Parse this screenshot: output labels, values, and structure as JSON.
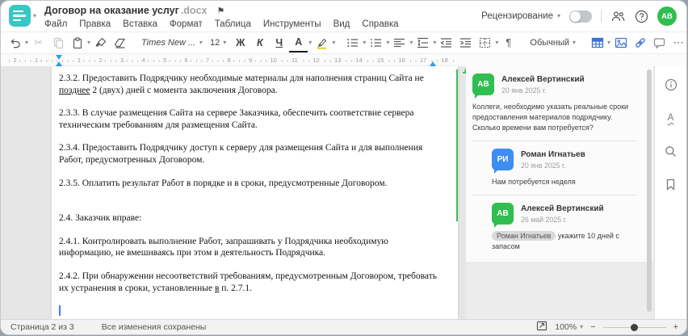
{
  "colors": {
    "teal": "#3ac7c3",
    "accent_blue": "#3d72d9",
    "green": "#2fbe4f",
    "blue_avatar": "#3d8df2",
    "marker_blue": "#2b9ff2",
    "cgreen": "#3fbe5c"
  },
  "icons": {
    "caret": "▾",
    "flag": "⚑",
    "cut": "✂",
    "more": "⋯",
    "minus": "−",
    "plus": "+",
    "pilcrow": "¶",
    "spell_letter": "А"
  },
  "app": {
    "title": "Договор на оказание услуг",
    "ext": ".docx"
  },
  "header": {
    "menu": [
      "Файл",
      "Правка",
      "Вставка",
      "Формат",
      "Таблица",
      "Инструменты",
      "Вид",
      "Справка"
    ],
    "review": "Рецензирование",
    "avatar": "АВ"
  },
  "toolbar": {
    "font": "Times New ...",
    "size": "12",
    "bold": "Ж",
    "italic": "К",
    "underline": "Ч",
    "color_letter": "А",
    "style": "Обычный"
  },
  "ruler": {
    "left_numbers": [
      "2",
      "1"
    ],
    "numbers": [
      "1",
      "2",
      "3",
      "4",
      "5",
      "6",
      "7",
      "8",
      "9",
      "10",
      "11",
      "12",
      "13",
      "14",
      "15",
      "16",
      "17",
      "18"
    ]
  },
  "document": {
    "paragraphs": [
      {
        "lines": [
          [
            {
              "t": "2.3.2. Предоставить Подрядчику необходимые материалы для наполнения страниц Сайта не"
            }
          ],
          [
            {
              "t": "позднее",
              "u": true
            },
            {
              "t": " 2 (двух) дней с момента заключения Договора."
            }
          ]
        ]
      },
      {
        "lines": [
          [
            {
              "t": "2.3.3. В случае размещения Сайта на сервере Заказчика, обеспечить соответствие сервера"
            }
          ],
          [
            {
              "t": "техническим требованиям для размещения Сайта."
            }
          ]
        ]
      },
      {
        "lines": [
          [
            {
              "t": "2.3.4. Предоставить Подрядчику доступ к серверу для размещения Сайта и для выполнения"
            }
          ],
          [
            {
              "t": "Работ, предусмотренных Договором."
            }
          ]
        ]
      },
      {
        "lines": [
          [
            {
              "t": "2.3.5. Оплатить результат Работ в порядке и в сроки, предусмотренные Договором."
            }
          ]
        ]
      },
      {
        "lines": []
      },
      {
        "lines": [
          [
            {
              "t": "2.4. Заказчик вправе:"
            }
          ]
        ]
      },
      {
        "lines": [
          [
            {
              "t": "2.4.1. Контролировать выполнение Работ, запрашивать у Подрядчика необходимую"
            }
          ],
          [
            {
              "t": "информацию, не вмешиваясь при этом в деятельность Подрядчика."
            }
          ]
        ]
      },
      {
        "lines": [
          [
            {
              "t": "2.4.2. При обнаружении несоответствий требованиям, предусмотренным Договором, требовать"
            }
          ],
          [
            {
              "t": "их устранения в сроки, установленные "
            },
            {
              "t": "в",
              "u": true
            },
            {
              "t": " п. 2.7.1."
            }
          ]
        ]
      }
    ]
  },
  "comments": [
    {
      "initials": "АВ",
      "color": "#2fbe4f",
      "name": "Алексей Вертинский",
      "date": "20 янв 2025 г.",
      "text": "Коллеги, необходимо указать реальные сроки предоставления материалов подрядчику. Сколько времени вам потребуется?",
      "reply": false
    },
    {
      "initials": "РИ",
      "color": "#3d8df2",
      "name": "Роман Игнатьев",
      "date": "20 янв 2025 г.",
      "text": "Нам потребуется неделя",
      "reply": true
    },
    {
      "initials": "АВ",
      "color": "#2fbe4f",
      "name": "Алексей Вертинский",
      "date": "26 май 2025 г.",
      "mention": "Роман Игнатьев",
      "text": "укажите 10 дней с запасом",
      "reply": true
    }
  ],
  "statusbar": {
    "page": "Страница 2 из 3",
    "saved": "Все изменения сохранены",
    "zoom": "100%"
  }
}
